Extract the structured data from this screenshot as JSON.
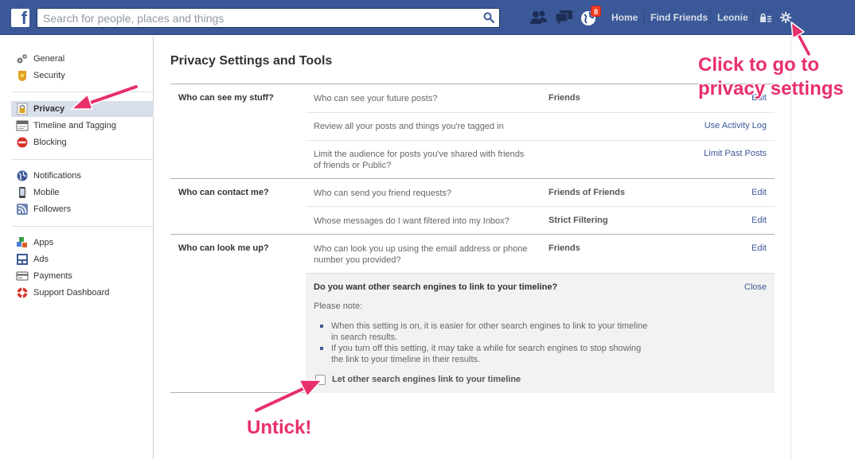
{
  "topbar": {
    "logo_letter": "f",
    "search_placeholder": "Search for people, places and things",
    "notification_count": "8",
    "nav": {
      "home": "Home",
      "find_friends": "Find Friends",
      "user": "Leonie"
    }
  },
  "sidebar": {
    "groups": [
      [
        {
          "label": "General",
          "icon": "gear-toggle-icon"
        },
        {
          "label": "Security",
          "icon": "badge-icon"
        }
      ],
      [
        {
          "label": "Privacy",
          "icon": "lock-icon",
          "active": true
        },
        {
          "label": "Timeline and Tagging",
          "icon": "timeline-icon"
        },
        {
          "label": "Blocking",
          "icon": "no-entry-icon"
        }
      ],
      [
        {
          "label": "Notifications",
          "icon": "globe-icon"
        },
        {
          "label": "Mobile",
          "icon": "phone-icon"
        },
        {
          "label": "Followers",
          "icon": "rss-icon"
        }
      ],
      [
        {
          "label": "Apps",
          "icon": "cubes-icon"
        },
        {
          "label": "Ads",
          "icon": "ads-icon"
        },
        {
          "label": "Payments",
          "icon": "card-icon"
        },
        {
          "label": "Support Dashboard",
          "icon": "lifebuoy-icon"
        }
      ]
    ]
  },
  "main": {
    "title": "Privacy Settings and Tools",
    "sections": [
      {
        "label": "Who can see my stuff?",
        "rows": [
          {
            "question": "Who can see your future posts?",
            "value": "Friends",
            "action": "Edit"
          },
          {
            "question": "Review all your posts and things you're tagged in",
            "value": "",
            "action": "Use Activity Log"
          },
          {
            "question": "Limit the audience for posts you've shared with friends of friends or Public?",
            "value": "",
            "action": "Limit Past Posts"
          }
        ]
      },
      {
        "label": "Who can contact me?",
        "rows": [
          {
            "question": "Who can send you friend requests?",
            "value": "Friends of Friends",
            "action": "Edit"
          },
          {
            "question": "Whose messages do I want filtered into my Inbox?",
            "value": "Strict Filtering",
            "action": "Edit"
          }
        ]
      },
      {
        "label": "Who can look me up?",
        "rows": [
          {
            "question": "Who can look you up using the email address or phone number you provided?",
            "value": "Friends",
            "action": "Edit"
          }
        ]
      }
    ],
    "search_panel": {
      "title": "Do you want other search engines to link to your timeline?",
      "close": "Close",
      "note": "Please note:",
      "bullets": [
        "When this setting is on, it is easier for other search engines to link to your timeline in search results.",
        "If you turn off this setting, it may take a while for search engines to stop showing the link to your timeline in their results."
      ],
      "checkbox_label": "Let other search engines link to your timeline",
      "checkbox_checked": false
    }
  },
  "annotations": {
    "privacy_settings": "Click to go to privacy settings",
    "untick": "Untick!",
    "color": "#e8306a"
  }
}
